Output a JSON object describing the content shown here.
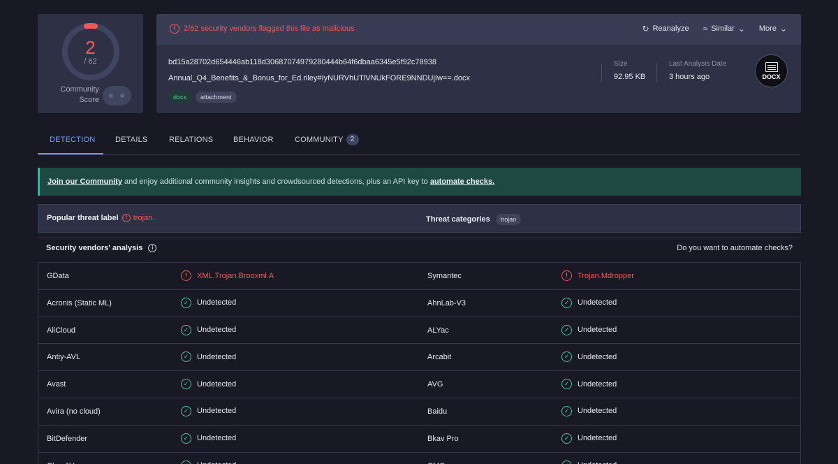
{
  "score": {
    "detections": "2",
    "total": "/ 62",
    "community_label_1": "Community",
    "community_label_2": "Score"
  },
  "summary": {
    "alert": "2/62 security vendors flagged this file as malicious",
    "actions": {
      "reanalyze": "Reanalyze",
      "similar": "Similar",
      "more": "More"
    },
    "hash": "bd15a28702d654446ab118d30687074979280444b64f6dbaa6345e5f92c78938",
    "filename": "Annual_Q4_Benefits_&_Bonus_for_Ed.riley#IyNURVhUTlVNUkFORE9NNDUjIw==.docx",
    "tags": [
      "docx",
      "attachment"
    ],
    "size_label": "Size",
    "size_value": "92.95 KB",
    "date_label": "Last Analysis Date",
    "date_value": "3 hours ago",
    "file_type": "DOCX"
  },
  "tabs": {
    "detection": "DETECTION",
    "details": "DETAILS",
    "relations": "RELATIONS",
    "behavior": "BEHAVIOR",
    "community": "COMMUNITY",
    "community_count": "2"
  },
  "banner": {
    "link1": "Join our Community",
    "middle": " and enjoy additional community insights and crowdsourced detections, plus an API key to ",
    "link2": "automate checks."
  },
  "threat": {
    "label": "Popular threat label",
    "value": "trojan.",
    "categories_label": "Threat categories",
    "category": "trojan"
  },
  "analysis": {
    "title": "Security vendors' analysis",
    "automate": "Do you want to automate checks?"
  },
  "vendors": [
    {
      "left": "GData",
      "left_result": "XML.Trojan.Brooxml.A",
      "left_bad": true,
      "right": "Symantec",
      "right_result": "Trojan.Mdropper",
      "right_bad": true
    },
    {
      "left": "Acronis (Static ML)",
      "left_result": "Undetected",
      "right": "AhnLab-V3",
      "right_result": "Undetected"
    },
    {
      "left": "AliCloud",
      "left_result": "Undetected",
      "right": "ALYac",
      "right_result": "Undetected"
    },
    {
      "left": "Antiy-AVL",
      "left_result": "Undetected",
      "right": "Arcabit",
      "right_result": "Undetected"
    },
    {
      "left": "Avast",
      "left_result": "Undetected",
      "right": "AVG",
      "right_result": "Undetected"
    },
    {
      "left": "Avira (no cloud)",
      "left_result": "Undetected",
      "right": "Baidu",
      "right_result": "Undetected"
    },
    {
      "left": "BitDefender",
      "left_result": "Undetected",
      "right": "Bkav Pro",
      "right_result": "Undetected"
    },
    {
      "left": "ClamAV",
      "left_result": "Undetected",
      "right": "CMC",
      "right_result": "Undetected"
    }
  ],
  "colors": {
    "malicious": "#f05a5a",
    "clean": "#4cc5a0",
    "accent": "#6f9cf7",
    "background": "#181924"
  }
}
